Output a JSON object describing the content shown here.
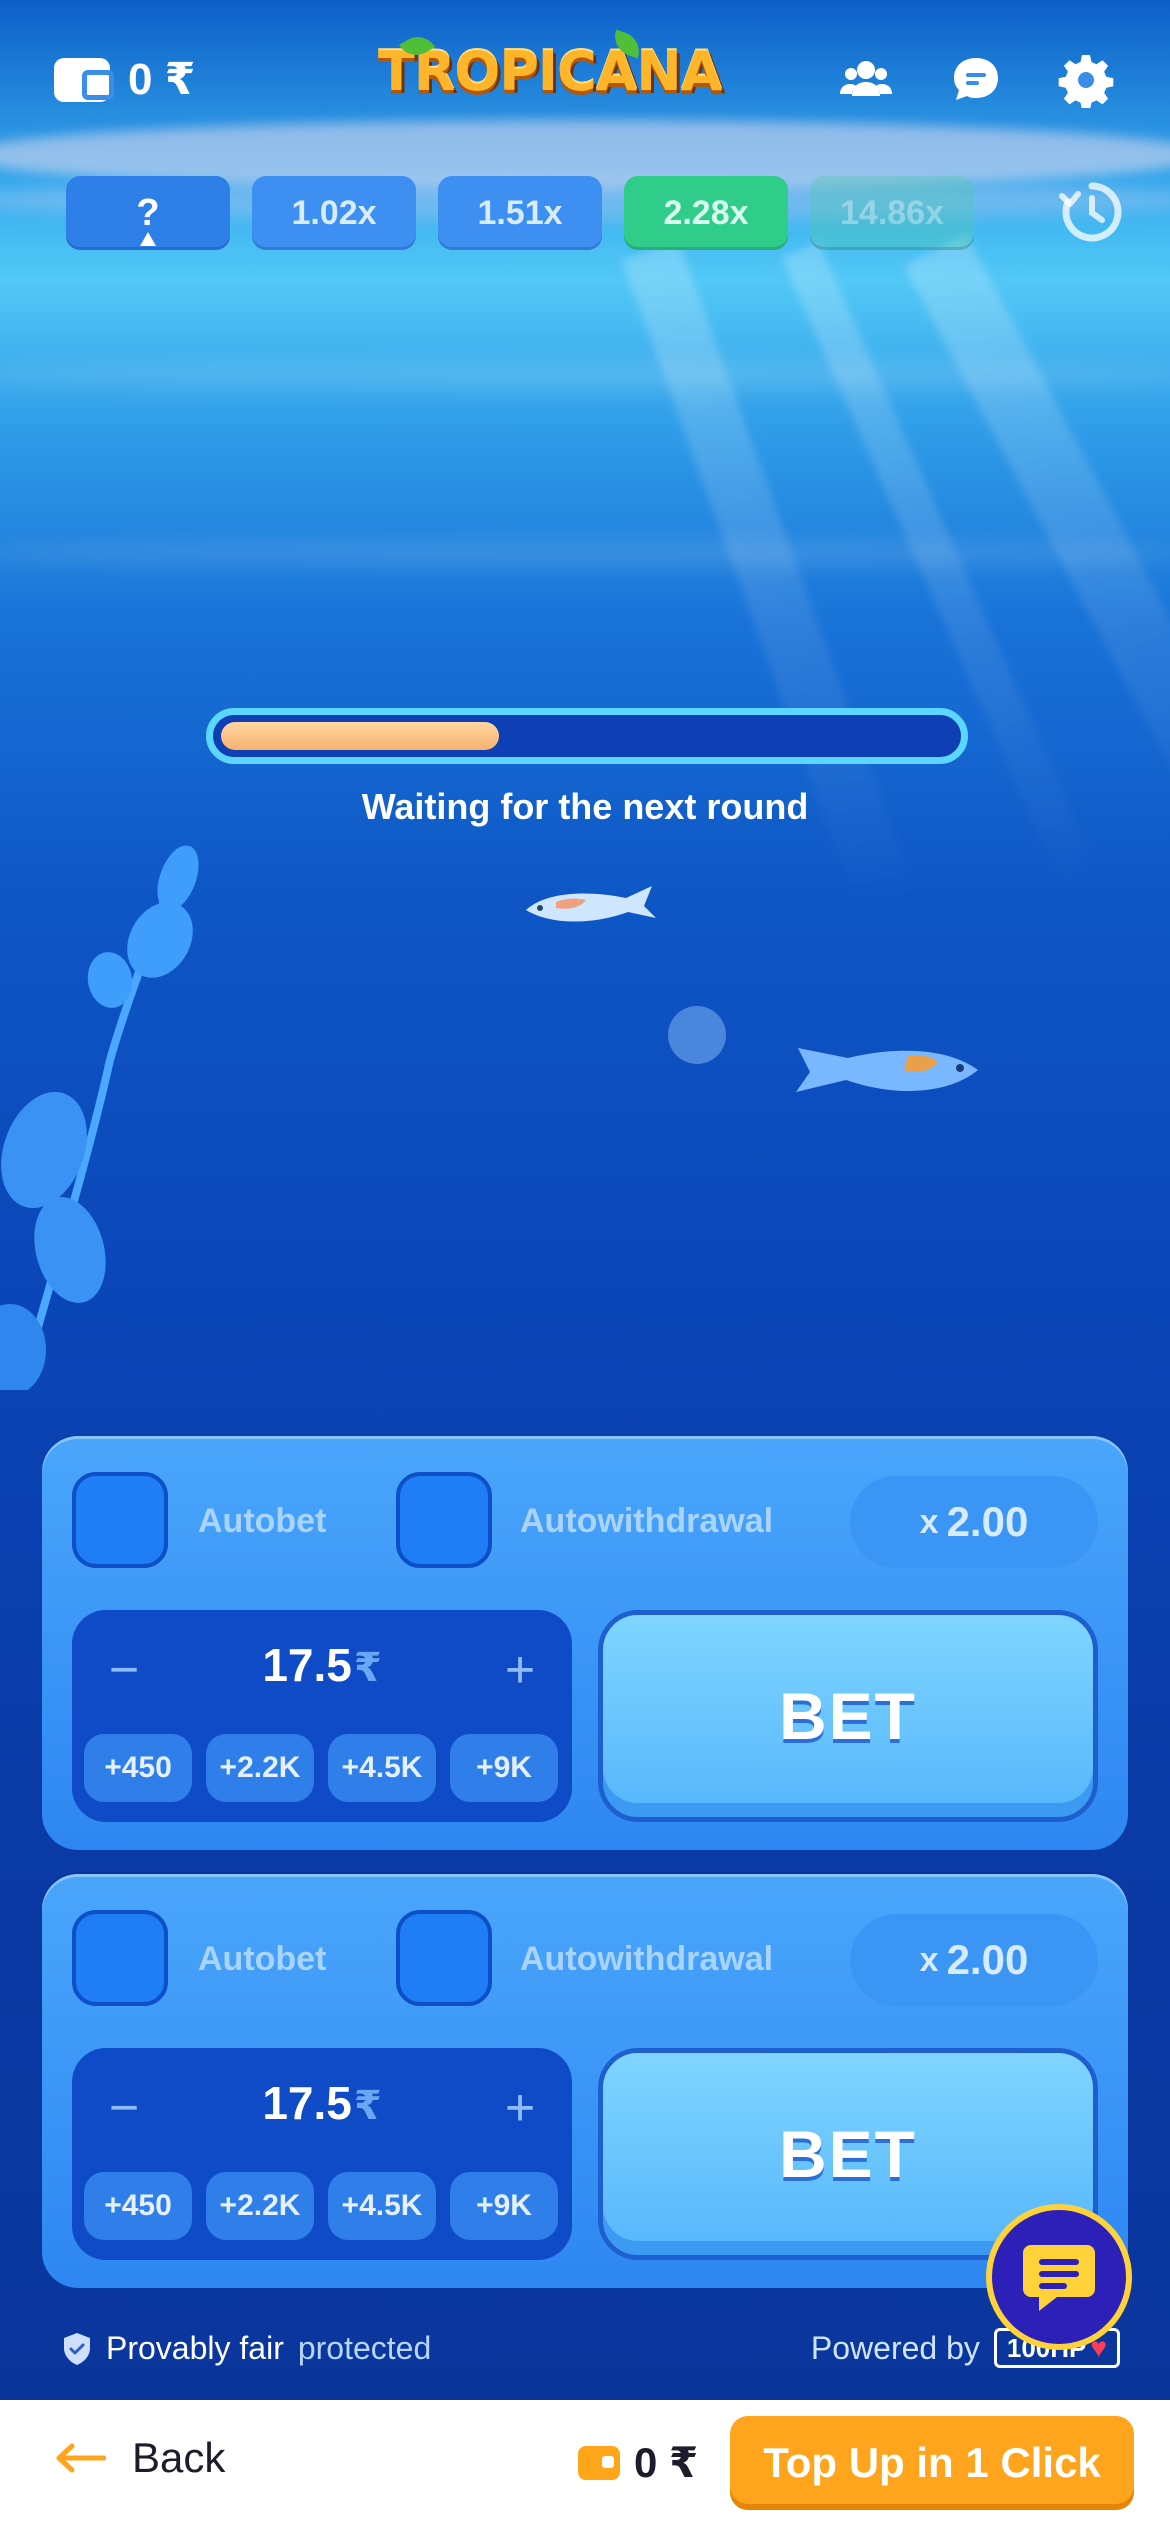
{
  "header": {
    "balance": "0 ₹",
    "logo": "TROPICANA"
  },
  "history": {
    "current": "?",
    "items": [
      "1.02x",
      "1.51x",
      "2.28x",
      "14.86x"
    ]
  },
  "round": {
    "status": "Waiting for the next round",
    "progress": 0.38
  },
  "panels": [
    {
      "autobet_label": "Autobet",
      "autowithdrawal_label": "Autowithdrawal",
      "multiplier_x": "x",
      "multiplier_value": "2.00",
      "minus": "−",
      "plus": "+",
      "stake": "17.5",
      "currency": "₹",
      "quick": [
        "+450",
        "+2.2K",
        "+4.5K",
        "+9K"
      ],
      "bet_label": "BET"
    },
    {
      "autobet_label": "Autobet",
      "autowithdrawal_label": "Autowithdrawal",
      "multiplier_x": "x",
      "multiplier_value": "2.00",
      "minus": "−",
      "plus": "+",
      "stake": "17.5",
      "currency": "₹",
      "quick": [
        "+450",
        "+2.2K",
        "+4.5K",
        "+9K"
      ],
      "bet_label": "BET"
    }
  ],
  "footer": {
    "provably": "Provably fair",
    "protected": "protected",
    "powered_by": "Powered by",
    "provider": "100HP"
  },
  "bottom_bar": {
    "back": "Back",
    "balance": "0 ₹",
    "topup": "Top Up in 1 Click"
  },
  "colors": {
    "accent_orange": "#ffa41c",
    "green_chip": "#2fcc8a",
    "panel_blue": "#2e86f2"
  }
}
